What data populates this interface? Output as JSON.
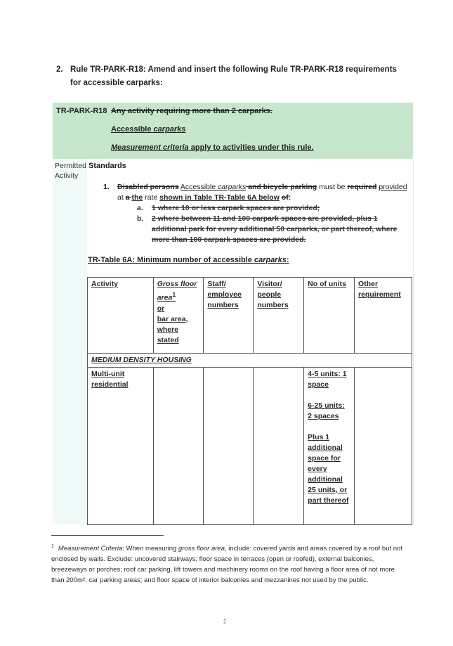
{
  "instruction": {
    "number": "2.",
    "text": "Rule TR-PARK-R18:  Amend and insert the following Rule TR-PARK-R18 requirements for accessible carparks:"
  },
  "rule_header": {
    "code": "TR-PARK-R18",
    "deleted_title": "Any activity requiring more than 2 carparks.",
    "new_title_prefix": "Accessible ",
    "new_title_italic": "carparks",
    "criteria_italic": "Measurement criteria",
    "criteria_rest": " apply to activities under this rule."
  },
  "status": {
    "label_line1": "Permitted",
    "label_line2": "Activity"
  },
  "standards": {
    "heading": "Standards",
    "item_number": "1.",
    "item_parts": {
      "del1": "Disabled persons",
      "ins1": "Accessible ",
      "ins1_italic": "carparks",
      "del2": " and bicycle parking",
      "plain1": " must be ",
      "del3": "required",
      "ins2": "provided",
      "plain2": " at ",
      "del4": "a ",
      "ins3": "the",
      "plain3": " rate ",
      "ins4": "shown in Table TR-Table 6A below",
      "plain4": " ",
      "del5": "of",
      "plain5": ":"
    },
    "sub_items": [
      {
        "label": "a.",
        "text": "1 where 10 or less carpark spaces are provided;"
      },
      {
        "label": "b.",
        "text": "2 where between 11 and 100 carpark spaces are provided, plus 1 additional park for every additional 50 carparks, or part thereof, where more than 100 carpark spaces are provided."
      }
    ]
  },
  "table": {
    "caption_prefix": "TR-Table 6A: Minimum number of accessible ",
    "caption_italic": "carparks",
    "caption_suffix": ":",
    "headers": {
      "activity": "Activity",
      "gfa_italic": "Gross floor area",
      "gfa_sup": "1",
      "gfa_or": "or",
      "gfa_rest": "bar area, where stated",
      "staff": "Staff/ employee numbers",
      "visitor": "Visitor/ people numbers",
      "units": "No of units",
      "other": "Other requirement"
    },
    "section_label": "MEDIUM DENSITY HOUSING",
    "rows": [
      {
        "activity": "Multi-unit residential",
        "gross_floor_area": "",
        "staff": "",
        "visitor": "",
        "units_1": "4-5 units: 1 space",
        "units_2": "6-25 units: 2 spaces",
        "units_3": "Plus 1 additional space for every additional 25 units, or part thereof",
        "other": ""
      }
    ]
  },
  "footnote": {
    "marker": "1",
    "title_italic": "Measurement Criteria",
    "text1": ": When measuring ",
    "text_italic": "gross floor area",
    "text2": ", include: covered yards and areas covered by a roof but not enclosed by walls. Exclude: uncovered stairways; floor space in terraces (open or roofed), external balconies, breezeways or porches; roof car parking, lift towers and machinery rooms on the roof having a floor area of not more than 200m²; car parking areas; and floor space of interior balconies and mezzanines not used by the public."
  },
  "page_number": "2"
}
